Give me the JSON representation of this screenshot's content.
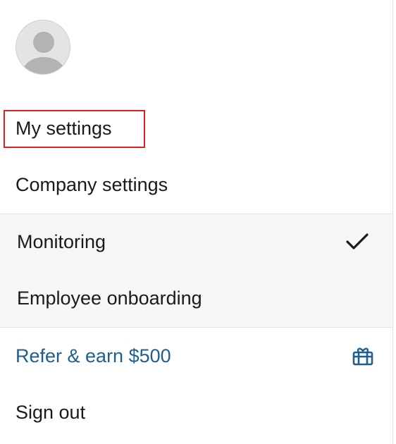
{
  "account_menu": {
    "avatar_alt": "User avatar",
    "items": {
      "my_settings": "My settings",
      "company_settings": "Company settings",
      "monitoring": "Monitoring",
      "employee_onboarding": "Employee onboarding",
      "refer_earn": "Refer & earn $500",
      "sign_out": "Sign out"
    },
    "selected_item": "Monitoring",
    "colors": {
      "link": "#1f5f8f",
      "highlight_border": "#e0201c",
      "submenu_bg": "#f6f6f6"
    },
    "icons": {
      "selected_check": "check-icon",
      "refer": "gift-icon",
      "avatar": "avatar-placeholder-icon"
    }
  }
}
